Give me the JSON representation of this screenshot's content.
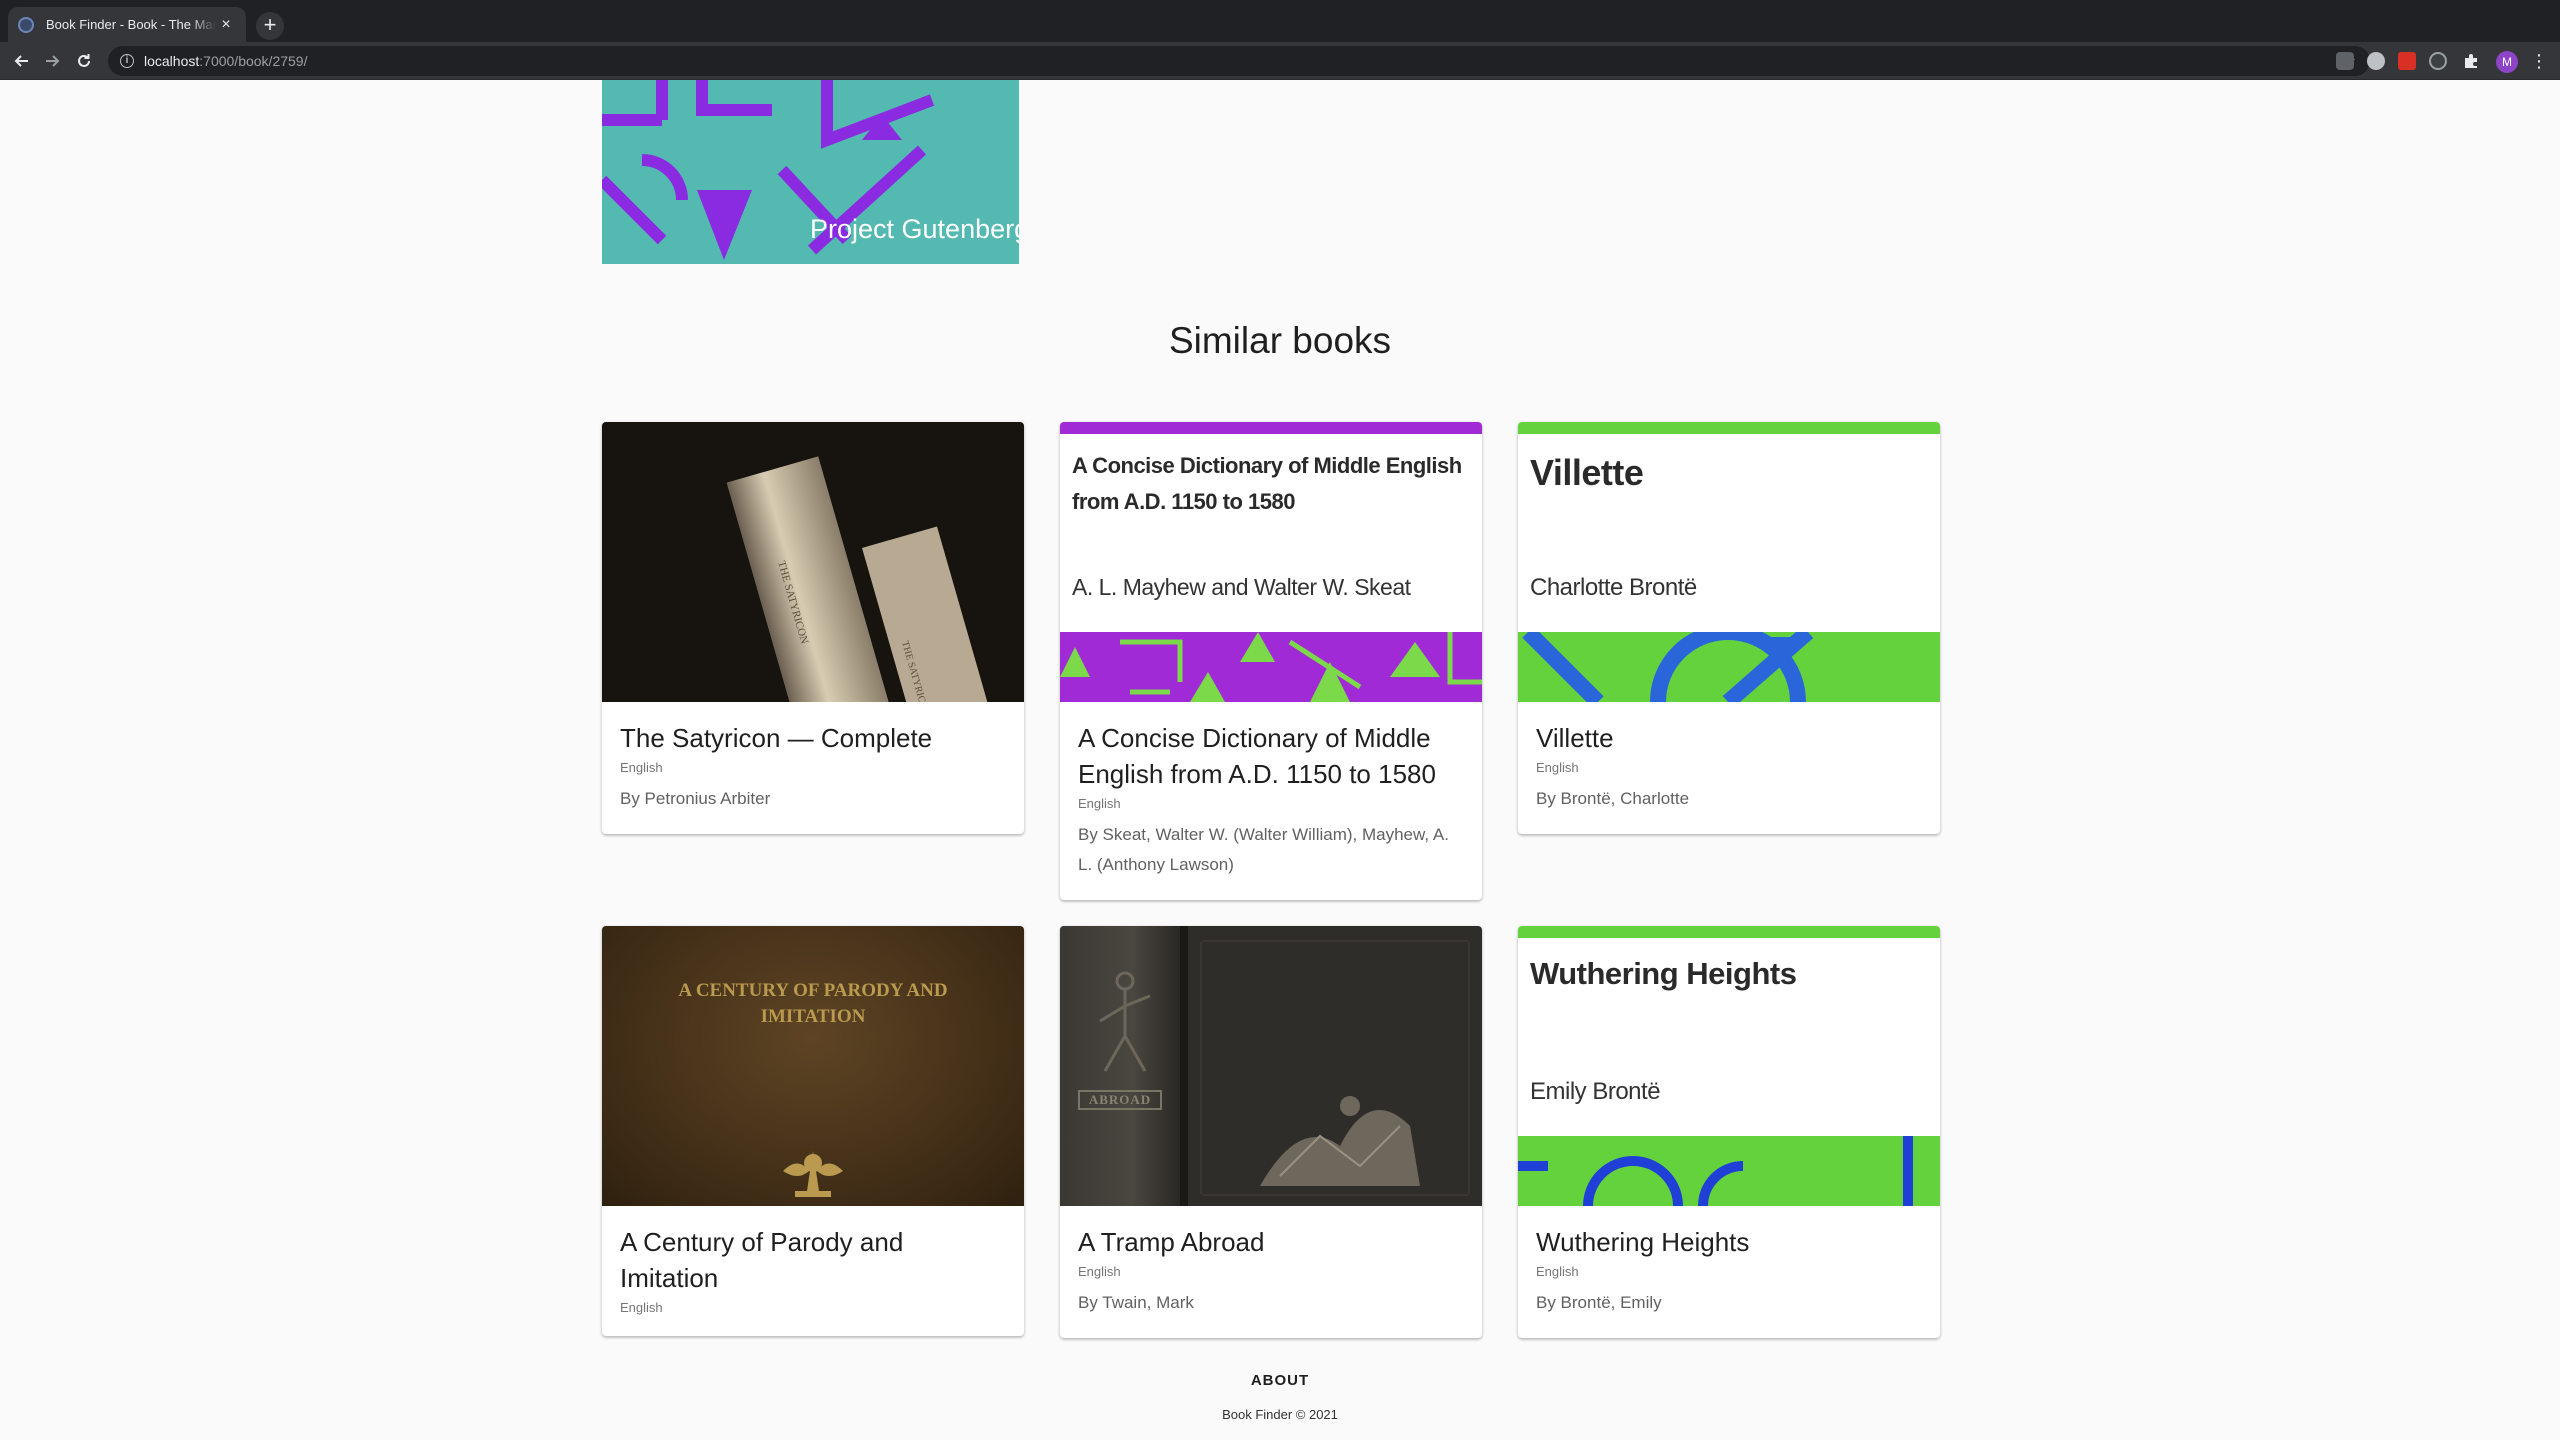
{
  "browser": {
    "tab_title": "Book Finder - Book - The Man",
    "tab_close": "×",
    "new_tab": "+",
    "url_host": "localhost",
    "url_path": ":7000/book/2759/",
    "profile_initial": "M"
  },
  "hero": {
    "cover_text": "Project Gutenberg"
  },
  "similar": {
    "heading": "Similar books",
    "books": [
      {
        "title": "The Satyricon — Complete",
        "language": "English",
        "author": "By Petronius Arbiter",
        "cover": {
          "spine_top": "THE SATYRICON",
          "spine_bottom": "THE SATYRICON"
        }
      },
      {
        "title": "A Concise Dictionary of Middle English from A.D. 1150 to 1580",
        "language": "English",
        "author": "By Skeat, Walter W. (Walter William), Mayhew, A. L. (Anthony Lawson)",
        "cover": {
          "title": "A Concise Dictionary of Middle English from A.D. 1150 to 1580",
          "author": "A. L. Mayhew and Walter W. Skeat",
          "accent": "#a02ad6"
        }
      },
      {
        "title": "Villette",
        "language": "English",
        "author": "By Brontë, Charlotte",
        "cover": {
          "title": "Villette",
          "author": "Charlotte Brontë",
          "accent": "#64d23c"
        }
      },
      {
        "title": "A Century of Parody and Imitation",
        "language": "English",
        "author": "",
        "cover": {
          "title": "A CENTURY OF PARODY AND IMITATION"
        }
      },
      {
        "title": "A Tramp Abroad",
        "language": "English",
        "author": "By Twain, Mark",
        "cover": {
          "spine": "ABROAD"
        }
      },
      {
        "title": "Wuthering Heights",
        "language": "English",
        "author": "By Brontë, Emily",
        "cover": {
          "title": "Wuthering Heights",
          "author": "Emily Brontë",
          "accent": "#64d23c"
        }
      }
    ]
  },
  "footer": {
    "about": "ABOUT",
    "copyright": "Book Finder © 2021"
  }
}
